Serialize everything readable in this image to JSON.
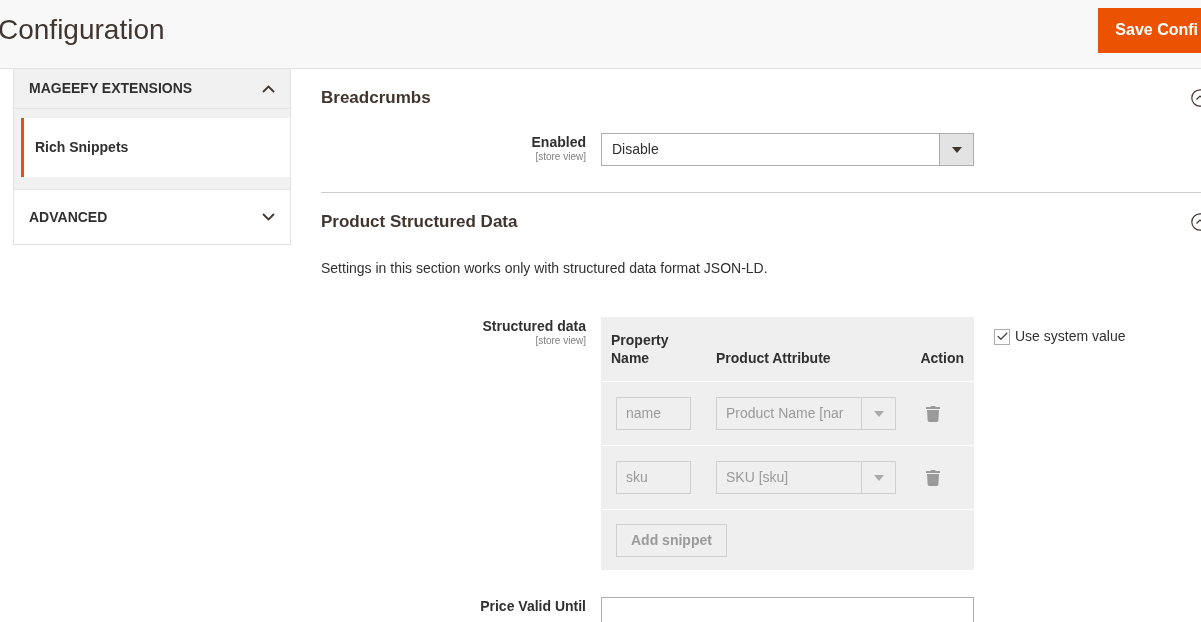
{
  "header": {
    "title": "Configuration",
    "save_button": "Save Confi"
  },
  "sidebar": {
    "sections": [
      {
        "label": "MAGEEFY EXTENSIONS",
        "expanded": true,
        "items": [
          {
            "label": "Rich Snippets",
            "selected": true
          }
        ]
      },
      {
        "label": "ADVANCED",
        "expanded": false
      }
    ]
  },
  "groups": [
    {
      "title": "Breadcrumbs",
      "expanded": true,
      "fields": [
        {
          "kind": "select",
          "label": "Enabled",
          "scope": "[store view]",
          "value": "Disable"
        }
      ]
    },
    {
      "title": "Product Structured Data",
      "expanded": true,
      "note": "Settings in this section works only with structured data format JSON-LD.",
      "fields": [
        {
          "kind": "table",
          "label": "Structured data",
          "scope": "[store view]",
          "disabled": true,
          "columns": [
            "Property Name",
            "Product Attribute",
            "Action"
          ],
          "rows": [
            {
              "property": "name",
              "attribute": "Product Name [nar"
            },
            {
              "property": "sku",
              "attribute": "SKU [sku]"
            }
          ],
          "add_button": "Add snippet",
          "use_system_value": {
            "label": "Use system value",
            "checked": true
          }
        },
        {
          "kind": "text",
          "label": "Price Valid Until"
        }
      ]
    }
  ]
}
